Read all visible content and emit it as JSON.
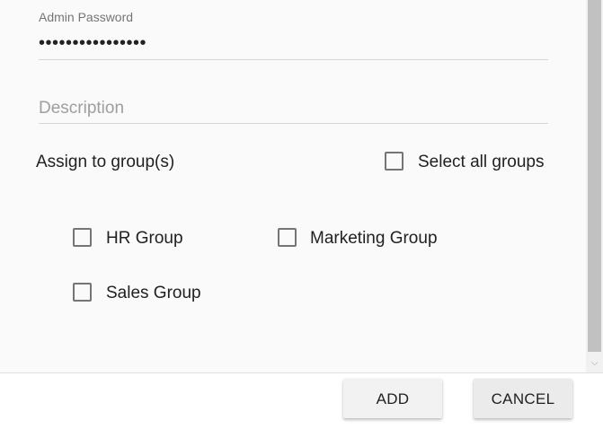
{
  "form": {
    "admin_password_label": "Admin Password",
    "admin_password_value": "••••••••••••••••",
    "description_placeholder": "Description",
    "assign_groups_label": "Assign to group(s)",
    "select_all_label": "Select all groups",
    "groups": [
      {
        "label": "HR Group",
        "checked": false
      },
      {
        "label": "Marketing Group",
        "checked": false
      },
      {
        "label": "Sales Group",
        "checked": false
      }
    ]
  },
  "footer": {
    "add_label": "ADD",
    "cancel_label": "CANCEL"
  },
  "colors": {
    "content_bg": "#fafafa",
    "button_bg": "#f2f2f2",
    "checkbox_border": "#757575"
  }
}
